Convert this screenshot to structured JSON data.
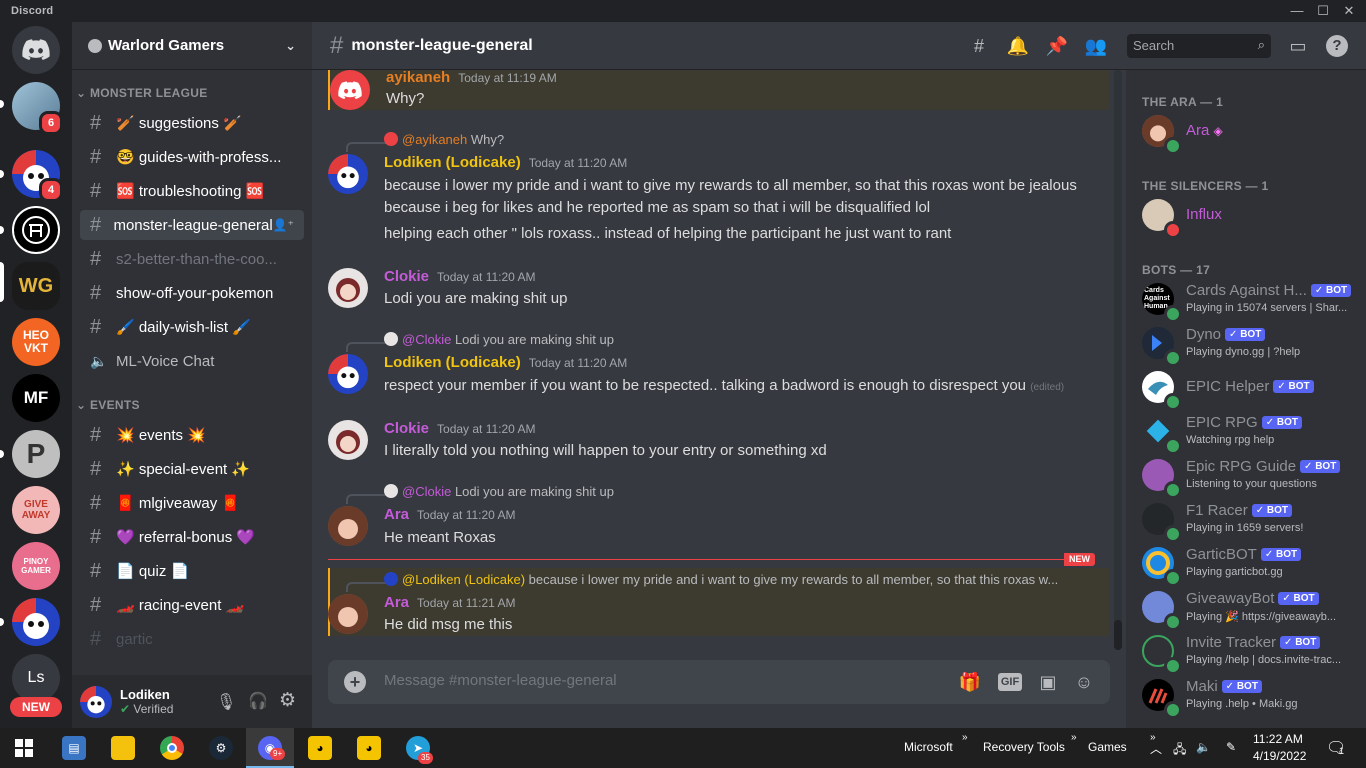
{
  "app": {
    "name": "Discord"
  },
  "colors": {
    "accent": "#5865f2",
    "mention_bg": "#3d3a2f",
    "new_line": "#ed4245",
    "online": "#3ba55d",
    "dnd": "#ed4245"
  },
  "servers": [
    {
      "label": "",
      "badge": "6"
    },
    {
      "label": "",
      "badge": "4"
    },
    {
      "label": "",
      "badge": ""
    },
    {
      "label": "WG",
      "badge": ""
    },
    {
      "label": "HEO VKT",
      "badge": ""
    },
    {
      "label": "MF",
      "badge": ""
    },
    {
      "label": "P",
      "badge": ""
    },
    {
      "label": "GIVE AWAY",
      "badge": ""
    },
    {
      "label": "PINOY GAMER",
      "badge": ""
    },
    {
      "label": "",
      "badge": ""
    },
    {
      "label": "Ls",
      "badge": ""
    }
  ],
  "new_badge": "NEW",
  "guild": {
    "name": "Warlord Gamers"
  },
  "categories": [
    "MONSTER LEAGUE",
    "EVENTS"
  ],
  "channels": [
    {
      "name": "🏏 suggestions 🏏"
    },
    {
      "name": "🤓 guides-with-profess..."
    },
    {
      "name": "🆘 troubleshooting 🆘"
    },
    {
      "name": "monster-league-general"
    },
    {
      "name": "s2-better-than-the-coo..."
    },
    {
      "name": "show-off-your-pokemon"
    },
    {
      "name": "🖌️ daily-wish-list 🖌️"
    },
    {
      "name": "ML-Voice Chat"
    },
    {
      "name": "💥 events 💥"
    },
    {
      "name": "✨ special-event ✨"
    },
    {
      "name": "🧧 mlgiveaway 🧧"
    },
    {
      "name": "💜 referral-bonus 💜"
    },
    {
      "name": "📄 quiz 📄"
    },
    {
      "name": "🏎️ racing-event 🏎️"
    },
    {
      "name": "gartic"
    }
  ],
  "user": {
    "name": "Lodiken",
    "status": "Verified"
  },
  "header": {
    "channel": "monster-league-general",
    "search_placeholder": "Search"
  },
  "messages": [
    {
      "author": "ayikaneh",
      "time": "Today at 11:19 AM",
      "text": "Why?"
    },
    {
      "reply_author": "@ayikaneh",
      "reply_text": "Why?",
      "author": "Lodiken (Lodicake)",
      "time": "Today at 11:20 AM",
      "text": "because i lower my pride and i want to give my rewards to all member, so that this roxas wont be jealous because i beg for likes and he reported me as spam so that i will be disqualified lol",
      "text2": "helping each other \" lols roxass.. instead of helping the participant he just want to rant"
    },
    {
      "author": "Clokie",
      "time": "Today at 11:20 AM",
      "text": "Lodi you are making shit up"
    },
    {
      "reply_author": "@Clokie",
      "reply_text": "Lodi you are making shit up",
      "author": "Lodiken (Lodicake)",
      "time": "Today at 11:20 AM",
      "text": "respect your member if you want to be respected.. talking a badword is enough to disrespect you",
      "edited": "(edited)"
    },
    {
      "author": "Clokie",
      "time": "Today at 11:20 AM",
      "text": "I literally told you nothing will happen to your entry or something xd"
    },
    {
      "reply_author": "@Clokie",
      "reply_text": "Lodi you are making shit up",
      "author": "Ara",
      "time": "Today at 11:20 AM",
      "text": "He meant Roxas"
    },
    {
      "reply_author": "@Lodiken (Lodicake)",
      "reply_text": "because i lower my pride and i want to give my rewards to all member, so that this roxas w...",
      "author": "Ara",
      "time": "Today at 11:21 AM",
      "text": "He did msg me this"
    }
  ],
  "new_divider": "NEW",
  "composer": {
    "placeholder": "Message #monster-league-general",
    "gif": "GIF"
  },
  "member_groups": [
    {
      "title": "THE ARA — 1"
    },
    {
      "title": "THE SILENCERS — 1"
    },
    {
      "title": "BOTS — 17"
    }
  ],
  "members": [
    {
      "name": "Ara",
      "activity": ""
    },
    {
      "name": "Influx",
      "activity": ""
    },
    {
      "name": "Cards Against H...",
      "activity": "Playing in 15074 servers | Shar...",
      "avatar_text": "Cards Against Human"
    },
    {
      "name": "Dyno",
      "activity": "Playing dyno.gg | ?help"
    },
    {
      "name": "EPIC Helper",
      "activity": ""
    },
    {
      "name": "EPIC RPG",
      "activity": "Watching rpg help"
    },
    {
      "name": "Epic RPG Guide",
      "activity": "Listening to your questions"
    },
    {
      "name": "F1 Racer",
      "activity": "Playing in 1659 servers!"
    },
    {
      "name": "GarticBOT",
      "activity": "Playing garticbot.gg"
    },
    {
      "name": "GiveawayBot",
      "activity": "Playing 🎉 https://giveawayb..."
    },
    {
      "name": "Invite Tracker",
      "activity": "Playing /help | docs.invite-trac..."
    },
    {
      "name": "Maki",
      "activity": "Playing .help • Maki.gg"
    }
  ],
  "bot_tag": "✓ BOT",
  "taskbar": {
    "items": [
      "Microsoft",
      "Recovery Tools",
      "Games"
    ],
    "time": "11:22 AM",
    "date": "4/19/2022",
    "discord_badge": "9+",
    "telegram_badge": "35",
    "notification_count": "1"
  }
}
